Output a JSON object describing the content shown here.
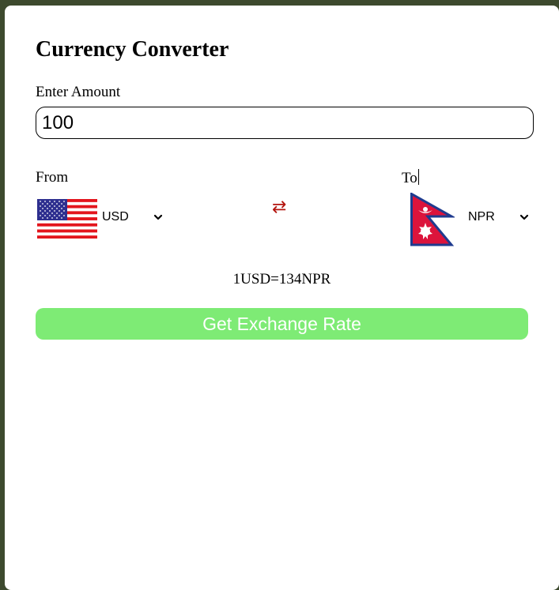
{
  "title": "Currency Converter",
  "amount": {
    "label": "Enter Amount",
    "value": "100"
  },
  "from": {
    "label": "From",
    "currency": "USD",
    "flag_icon": "us-flag-icon"
  },
  "to": {
    "label": "To",
    "currency": "NPR",
    "flag_icon": "nepal-flag-icon"
  },
  "swap_icon": "swap-arrows-icon",
  "swap_glyph": "⇄",
  "rate_text": "1USD=134NPR",
  "button_label": "Get Exchange Rate",
  "colors": {
    "background": "#3d4a2e",
    "card": "#ffffff",
    "button": "#7eeb75",
    "swap": "#b3140e"
  }
}
